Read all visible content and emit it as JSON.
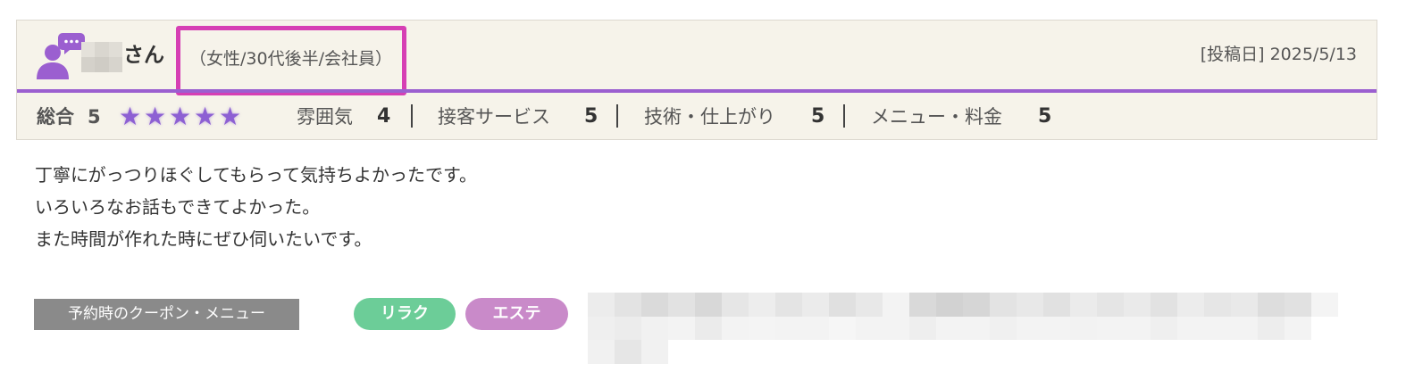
{
  "review": {
    "reviewer_suffix": "さん",
    "reviewer_attributes": "（女性/30代後半/会社員）",
    "post_date": "[投稿日] 2025/5/13",
    "overall_label": "総合",
    "overall_score": "5",
    "overall_stars": 5,
    "sub_ratings": [
      {
        "label": "雰囲気",
        "value": "4"
      },
      {
        "label": "接客サービス",
        "value": "5"
      },
      {
        "label": "技術・仕上がり",
        "value": "5"
      },
      {
        "label": "メニュー・料金",
        "value": "5"
      }
    ],
    "comment_lines": [
      "丁寧にがっつりほぐしてもらって気持ちよかったです。",
      "いろいろなお話もできてよかった。",
      "また時間が作れた時にぜひ伺いたいです。"
    ],
    "coupon_label": "予約時のクーポン・メニュー",
    "tags": [
      {
        "label": "リラク",
        "color": "#6ccd98"
      },
      {
        "label": "エステ",
        "color": "#c98ac9"
      }
    ]
  },
  "colors": {
    "accent_purple": "#9b5fd0",
    "highlight_magenta": "#d63fb4",
    "header_bg": "#f6f3ea",
    "star_color": "#8d60d3",
    "coupon_label_bg": "#8a8a8a"
  },
  "icons": {
    "avatar": "user-comment-icon",
    "star": "star-icon"
  }
}
